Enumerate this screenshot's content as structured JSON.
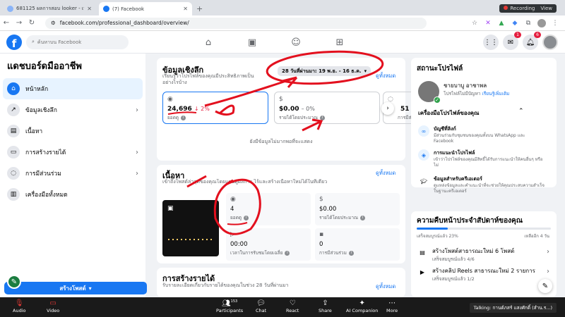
{
  "browser": {
    "tabs": [
      {
        "title": "681125 ผลการสอบ looker - เทค"
      },
      {
        "title": "(7) Facebook"
      }
    ],
    "url": "facebook.com/professional_dashboard/overview/",
    "recording": "Recording",
    "view": "View"
  },
  "fb": {
    "search_placeholder": "ค้นหาบน Facebook",
    "notif_msgs": "1",
    "notif_bell": "6"
  },
  "sidebar": {
    "title": "แดชบอร์ดมืออาชีพ",
    "items": [
      {
        "label": "หน้าหลัก"
      },
      {
        "label": "ข้อมูลเชิงลึก"
      },
      {
        "label": "เนื้อหา"
      },
      {
        "label": "การสร้างรายได้"
      },
      {
        "label": "การมีส่วนร่วม"
      },
      {
        "label": "เครื่องมือทั้งหมด"
      }
    ],
    "create": "สร้างโพสต์"
  },
  "insights": {
    "title": "ข้อมูลเชิงลึก",
    "sub": "เรียนรู้ว่าโปรไฟล์ของคุณมีประสิทธิภาพเป็นอย่างไรบ้าง",
    "see_all": "ดูทั้งหมด",
    "date_range": "28 วันที่ผ่านมา: 19 พ.ย. - 16 ธ.ค.",
    "m1_value": "24,696",
    "m1_change": "↓ 2%",
    "m1_label": "ยอดดู",
    "m2_value": "$0.00",
    "m2_change": "– 0%",
    "m2_label": "รายได้โดยประมาณ",
    "m3_value": "51",
    "m3_label": "การมีส่วนร่วม",
    "note": "ยังมีข้อมูลไม่มากพอที่จะแสดง"
  },
  "content": {
    "title": "เนื้อหา",
    "sub": "เข้าถึงโพสต์ล่าสุดของคุณโดยแผนดูผลการ ไร้และสร้างเนื้อหาใหม่ได้ในที่เดียว",
    "see_all": "ดูทั้งหมด",
    "views": "4",
    "views_label": "ยอดดู",
    "earn": "$0.00",
    "earn_label": "รายได้โดยประมาณ",
    "time": "00:00",
    "time_label": "เวลาในการรับชมโดยเฉลี่ย",
    "engage": "0",
    "engage_label": "การมีส่วนร่วม"
  },
  "monet": {
    "title": "การสร้างรายได้",
    "sub": "รับรายละเอียดเกี่ยวกับรายได้ของคุณในช่วง 28 วันที่ผ่านมา",
    "see_all": "ดูทั้งหมด"
  },
  "status": {
    "title": "สถานะโปรไฟล์",
    "name": "ชายบาบู อาชาพล",
    "warn": "โปรไฟล์ไม่มีปัญหา",
    "learn": "เรียนรู้เพิ่มเติม",
    "tools_title": "เครื่องมือโปรไฟล์ของคุณ",
    "tools": [
      {
        "t": "บัญชีที่ลิงก์",
        "d": "มีส่วนร่วมกับชุมชนของคุณทั้งบน WhatsApp และ Facebook"
      },
      {
        "t": "การแนะนำโปรไฟล์",
        "d": "เข้าว่าโปรไฟล์ของคุณมีสิทธิ์ได้รับการแนะนำให้คนอื่นๆ หรือไม่"
      },
      {
        "t": "ข้อมูลสำหรับครีเอเตอร์",
        "d": "ดูแหล่งข้อมูลและคำแนะนำที่จะช่วยให้คุณประสบความสำเร็จในฐานะครีเอเตอร์"
      }
    ]
  },
  "progress": {
    "title": "ความคืบหน้าประจำสัปดาห์ของคุณ",
    "done": "เสร็จสมบูรณ์แล้ว 23%",
    "left": "เหลืออีก 4 วัน",
    "fraction": 0.23,
    "tasks": [
      {
        "t": "สร้างโพสต์สาธารณะใหม่ 6 โพสต์",
        "s": "เสร็จสมบูรณ์แล้ว 4/6"
      },
      {
        "t": "สร้างคลิป Reels สาธารณะใหม่ 2 รายการ",
        "s": "เสร็จสมบูรณ์แล้ว 1/2"
      }
    ]
  },
  "zoom": {
    "audio": "Audio",
    "video": "Video",
    "participants": "Participants",
    "participants_count": "153",
    "chat": "Chat",
    "react": "React",
    "share": "Share",
    "ai": "AI Companion",
    "more": "More",
    "talking": "Talking: กานต์ภสร์ แสงศักดิ์ (สำน.ร...)"
  }
}
